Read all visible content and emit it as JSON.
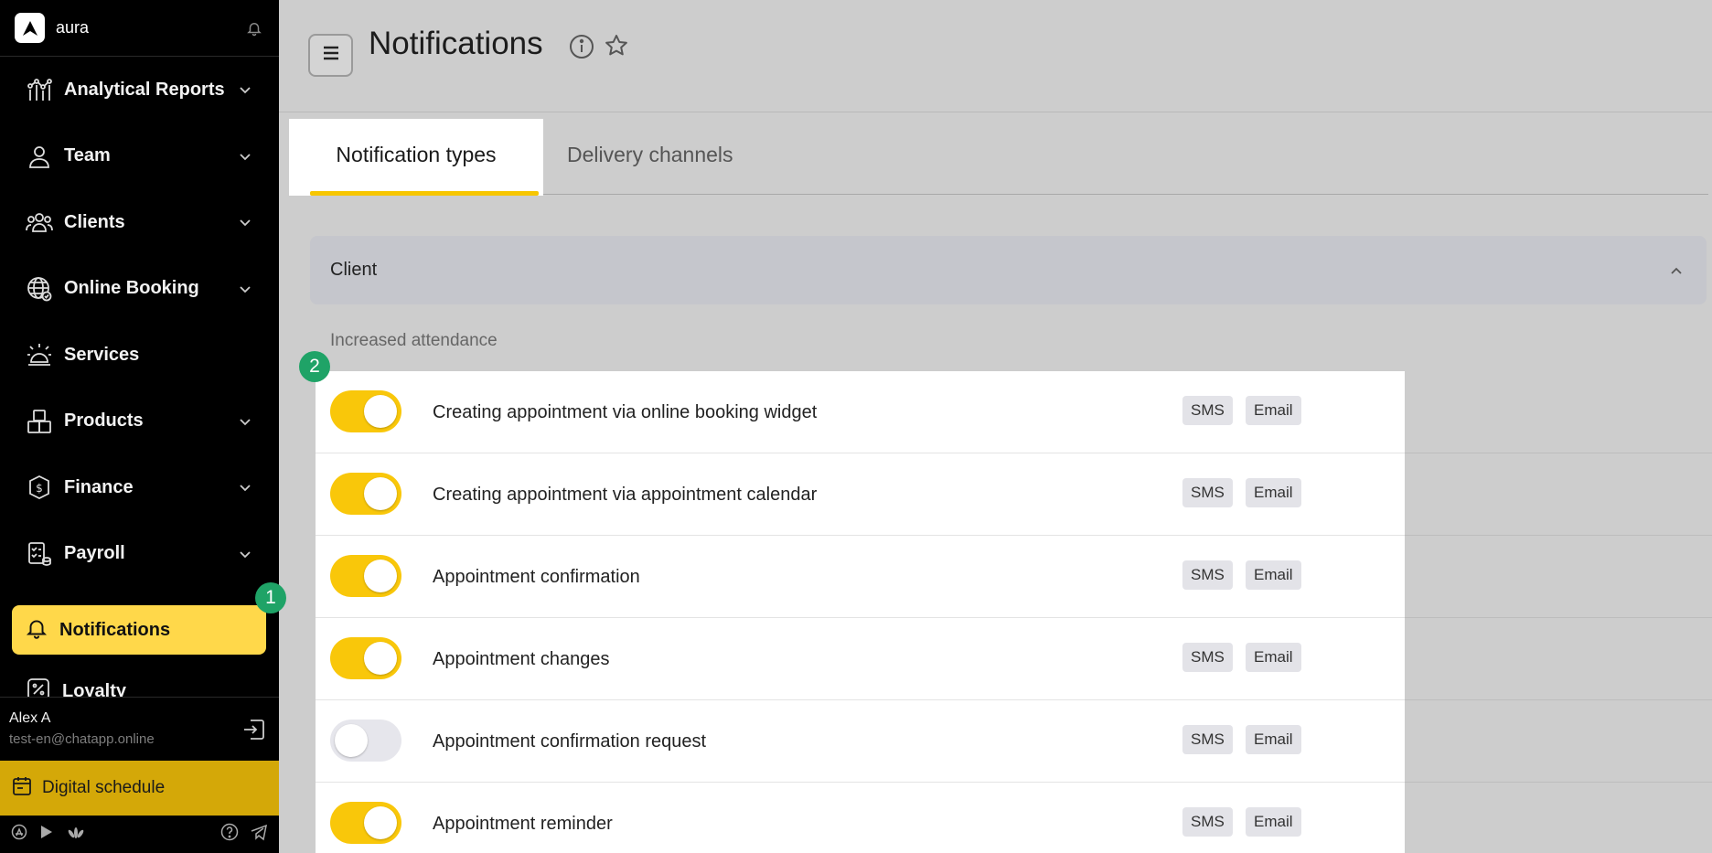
{
  "app": {
    "name": "aura"
  },
  "sidebar": {
    "items": [
      {
        "label": "Analytical Reports",
        "icon": "analytics-icon"
      },
      {
        "label": "Team",
        "icon": "person-icon"
      },
      {
        "label": "Clients",
        "icon": "clients-icon"
      },
      {
        "label": "Online Booking",
        "icon": "globe-icon"
      },
      {
        "label": "Services",
        "icon": "service-bell-icon"
      },
      {
        "label": "Products",
        "icon": "boxes-icon"
      },
      {
        "label": "Finance",
        "icon": "finance-icon"
      },
      {
        "label": "Payroll",
        "icon": "payroll-icon"
      }
    ],
    "active": {
      "label": "Notifications",
      "icon": "bell-icon"
    },
    "partial": {
      "label": "Loyalty",
      "icon": "loyalty-icon"
    },
    "user": {
      "name": "Alex A",
      "email": "test-en@chatapp.online"
    },
    "digital_schedule": "Digital schedule"
  },
  "badges": {
    "one": "1",
    "two": "2"
  },
  "header": {
    "title": "Notifications"
  },
  "tabs": [
    {
      "label": "Notification types",
      "active": true
    },
    {
      "label": "Delivery channels",
      "active": false
    }
  ],
  "section": {
    "title": "Client",
    "subtitle": "Increased attendance",
    "rows": [
      {
        "label": "Creating appointment via online booking widget",
        "enabled": true,
        "channels": [
          "SMS",
          "Email"
        ]
      },
      {
        "label": "Creating appointment via appointment calendar",
        "enabled": true,
        "channels": [
          "SMS",
          "Email"
        ]
      },
      {
        "label": "Appointment confirmation",
        "enabled": true,
        "channels": [
          "SMS",
          "Email"
        ]
      },
      {
        "label": "Appointment changes",
        "enabled": true,
        "channels": [
          "SMS",
          "Email"
        ]
      },
      {
        "label": "Appointment confirmation request",
        "enabled": false,
        "channels": [
          "SMS",
          "Email"
        ]
      },
      {
        "label": "Appointment reminder",
        "enabled": true,
        "channels": [
          "SMS",
          "Email"
        ]
      }
    ]
  },
  "colors": {
    "accent": "#f9c70a",
    "active_nav": "#ffd84a",
    "badge": "#1fa367",
    "digital": "#d4a808"
  }
}
